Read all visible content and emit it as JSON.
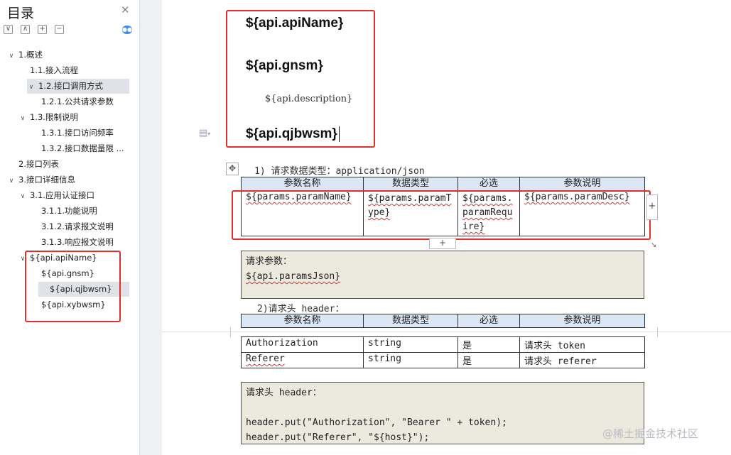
{
  "sidebar": {
    "title": "目录",
    "tools": [
      "∨",
      "∧",
      "+",
      "−"
    ],
    "items": [
      {
        "label": "1.概述",
        "level": 0,
        "arrow": true
      },
      {
        "label": "1.1.接入流程",
        "level": 1,
        "arrow": false
      },
      {
        "label": "1.2.接口调用方式",
        "level": 1,
        "arrow": true,
        "selected": true
      },
      {
        "label": "1.2.1.公共请求参数",
        "level": 2,
        "arrow": false
      },
      {
        "label": "1.3.限制说明",
        "level": 1,
        "arrow": true
      },
      {
        "label": "1.3.1.接口访问频率",
        "level": 2,
        "arrow": false
      },
      {
        "label": "1.3.2.接口数据量限 ...",
        "level": 2,
        "arrow": false
      },
      {
        "label": "2.接口列表",
        "level": 0,
        "arrow": false
      },
      {
        "label": "3.接口详细信息",
        "level": 0,
        "arrow": true
      },
      {
        "label": "3.1.应用认证接口",
        "level": 1,
        "arrow": true
      },
      {
        "label": "3.1.1.功能说明",
        "level": 2,
        "arrow": false
      },
      {
        "label": "3.1.2.请求报文说明",
        "level": 2,
        "arrow": false
      },
      {
        "label": "3.1.3.响应报文说明",
        "level": 2,
        "arrow": false
      },
      {
        "label": "${api.apiName}",
        "level": 1,
        "arrow": true
      },
      {
        "label": "${api.gnsm}",
        "level": 2,
        "arrow": false
      },
      {
        "label": "${api.qjbwsm}",
        "level": 2,
        "arrow": false,
        "selected": true
      },
      {
        "label": "${api.xybwsm}",
        "level": 2,
        "arrow": false
      }
    ]
  },
  "document": {
    "heading_api_name": "${api.apiName}",
    "heading_gnsm": "${api.gnsm}",
    "description": "${api.description}",
    "heading_qjbwsm": "${api.qjbwsm}",
    "request_type_line": "1)  请求数据类型：application/json",
    "param_table": {
      "headers": [
        "参数名称",
        "数据类型",
        "必选",
        "参数说明"
      ],
      "row": [
        "${params.paramName}",
        "${params.paramType}",
        "${params.paramRequire}",
        "${params.paramDesc}"
      ]
    },
    "request_params_box": {
      "label": "请求参数：",
      "value": "${api.paramsJson}"
    },
    "header_line": "2)请求头 header：",
    "header_table": {
      "headers": [
        "参数名称",
        "数据类型",
        "必选",
        "参数说明"
      ],
      "rows": [
        [
          "Authorization",
          "string",
          "是",
          "请求头 token"
        ],
        [
          "Referer",
          "string",
          "是",
          "请求头 referer"
        ]
      ]
    },
    "header_code_box": {
      "line1": "请求头 header：",
      "line2": "header.put(\"Authorization\", \"Bearer \" + token);",
      "line3": "header.put(\"Referer\", \"${host}\");"
    }
  },
  "watermark": "@稀土掘金技术社区",
  "colors": {
    "highlight_box": "#e0302b",
    "table_header": "#dbe7f4",
    "code_box": "#eceadf",
    "sidebar_selected": "#dfe3e8"
  }
}
